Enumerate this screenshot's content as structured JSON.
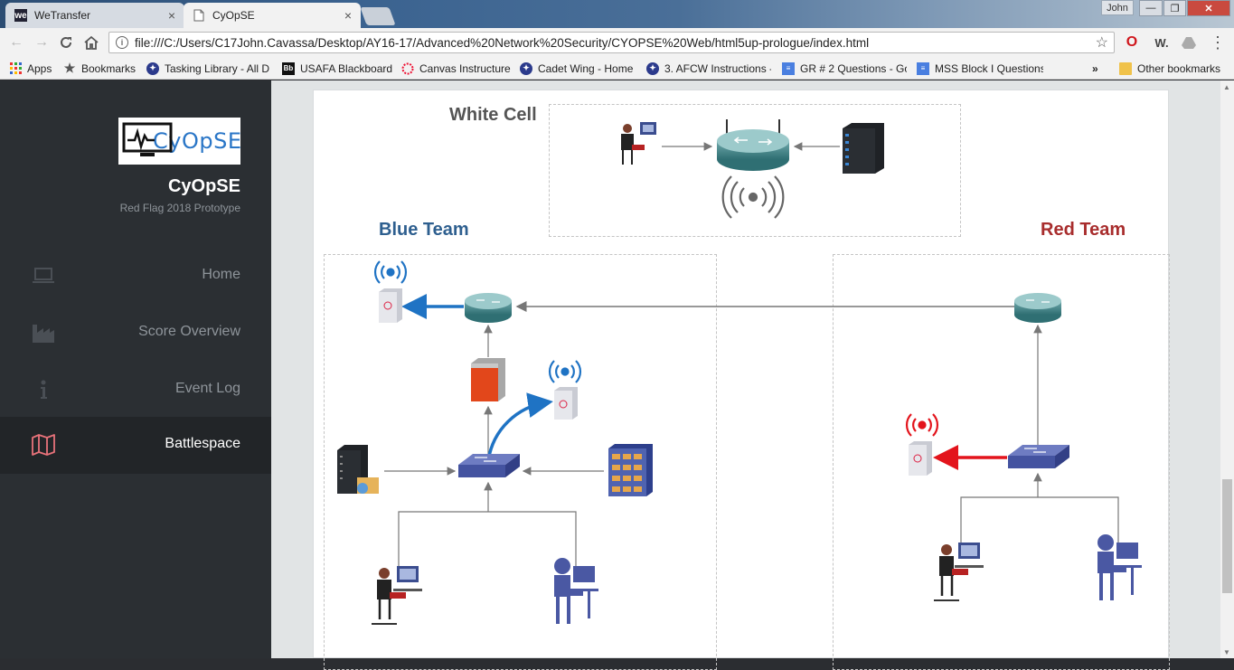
{
  "browser": {
    "tabs": [
      {
        "title": "WeTransfer",
        "icon": "we"
      },
      {
        "title": "CyOpSE",
        "icon": "doc"
      }
    ],
    "user": "John",
    "url": "file:///C:/Users/C17John.Cavassa/Desktop/AY16-17/Advanced%20Network%20Security/CYOPSE%20Web/html5up-prologue/index.html",
    "bookmarks": [
      {
        "label": "Apps",
        "icon": "apps-icon"
      },
      {
        "label": "Bookmarks",
        "icon": "star-icon"
      },
      {
        "label": "Tasking Library - All D",
        "icon": "seal-icon"
      },
      {
        "label": "USAFA Blackboard",
        "icon": "blackboard-icon"
      },
      {
        "label": "Canvas Instructure",
        "icon": "canvas-icon"
      },
      {
        "label": "Cadet Wing - Home",
        "icon": "seal-icon"
      },
      {
        "label": "3. AFCW Instructions -",
        "icon": "seal-icon"
      },
      {
        "label": "GR # 2 Questions - Go",
        "icon": "doc-icon"
      },
      {
        "label": "MSS Block I Questions",
        "icon": "doc-icon"
      }
    ],
    "overflow": "»",
    "other_bookmarks": "Other bookmarks"
  },
  "sidebar": {
    "logo_text": "CyOpSE",
    "title": "CyOpSE",
    "subtitle": "Red Flag 2018 Prototype",
    "items": [
      {
        "label": "Home",
        "icon": "laptop-icon",
        "active": false
      },
      {
        "label": "Score Overview",
        "icon": "factory-icon",
        "active": false
      },
      {
        "label": "Event Log",
        "icon": "info-icon",
        "active": false
      },
      {
        "label": "Battlespace",
        "icon": "map-icon",
        "active": true
      }
    ]
  },
  "diagram": {
    "white_cell_label": "White Cell",
    "blue_team_label": "Blue Team",
    "red_team_label": "Red Team",
    "colors": {
      "blue": "#2e5f8f",
      "red": "#a82d2d",
      "blue_arrow": "#1f73c4",
      "red_arrow": "#e3141c"
    }
  }
}
